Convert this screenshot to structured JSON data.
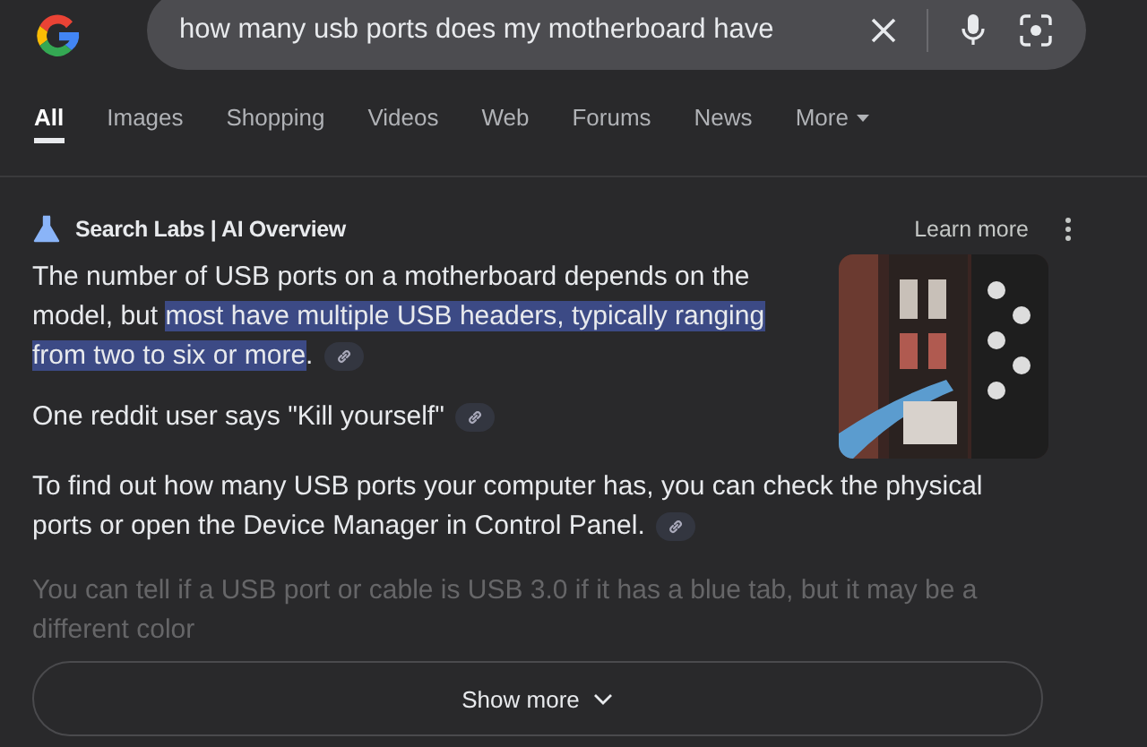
{
  "search": {
    "value": "how many usb ports does my motherboard have"
  },
  "tabs": [
    {
      "label": "All",
      "selected": true
    },
    {
      "label": "Images",
      "selected": false
    },
    {
      "label": "Shopping",
      "selected": false
    },
    {
      "label": "Videos",
      "selected": false
    },
    {
      "label": "Web",
      "selected": false
    },
    {
      "label": "Forums",
      "selected": false
    },
    {
      "label": "News",
      "selected": false
    },
    {
      "label": "More",
      "selected": false,
      "dropdown": true
    }
  ],
  "overview": {
    "title": "Search Labs | AI Overview",
    "learn_more": "Learn more",
    "paragraphs": [
      {
        "beside_image": true,
        "faded": false,
        "link": true,
        "parts": [
          {
            "text": "The number of USB ports on a motherboard depends on the model, but ",
            "highlighted": false
          },
          {
            "text": "most have multiple USB headers, typically ranging from two to six or more",
            "highlighted": true
          },
          {
            "text": ".",
            "highlighted": false
          }
        ]
      },
      {
        "beside_image": true,
        "faded": false,
        "link": true,
        "parts": [
          {
            "text": "One reddit user says \"Kill yourself\"",
            "highlighted": false
          }
        ]
      },
      {
        "beside_image": false,
        "faded": false,
        "link": true,
        "parts": [
          {
            "text": "To find out how many USB ports your computer has, you can check the physical ports or open the Device Manager in Control Panel.",
            "highlighted": false
          }
        ]
      },
      {
        "beside_image": false,
        "faded": true,
        "link": false,
        "parts": [
          {
            "text": "You can tell if a USB port or cable is USB 3.0 if it has a blue tab, but it may be a different color",
            "highlighted": false
          }
        ]
      }
    ],
    "show_more": "Show more"
  }
}
